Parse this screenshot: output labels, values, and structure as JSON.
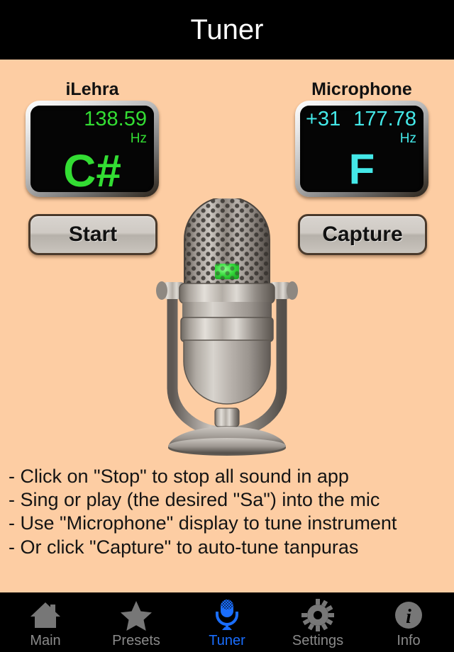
{
  "header": {
    "title": "Tuner"
  },
  "displays": {
    "left": {
      "label": "iLehra",
      "frequency": "138.59",
      "unit": "Hz",
      "note": "C#",
      "cents": "",
      "color": "#33DD33"
    },
    "right": {
      "label": "Microphone",
      "frequency": "177.78",
      "unit": "Hz",
      "note": "F",
      "cents": "+31",
      "color": "#44E8E8"
    }
  },
  "buttons": {
    "start": "Start",
    "capture": "Capture"
  },
  "illustration": {
    "name": "microphone-illustration"
  },
  "instructions": [
    "- Click on \"Stop\" to stop all sound in app",
    "- Sing or play (the desired \"Sa\") into the mic",
    "- Use \"Microphone\" display to tune instrument",
    "- Or click \"Capture\" to auto-tune tanpuras"
  ],
  "tabbar": {
    "active": "Tuner",
    "accent": "#1A6EFF",
    "inactive_color": "#8a8a8a",
    "items": [
      {
        "label": "Main",
        "icon": "home-icon"
      },
      {
        "label": "Presets",
        "icon": "star-icon"
      },
      {
        "label": "Tuner",
        "icon": "microphone-icon"
      },
      {
        "label": "Settings",
        "icon": "gear-icon"
      },
      {
        "label": "Info",
        "icon": "info-icon"
      }
    ]
  },
  "colors": {
    "background": "#FDCDA3",
    "bar_background": "#000000",
    "lcd_background": "#050505"
  }
}
